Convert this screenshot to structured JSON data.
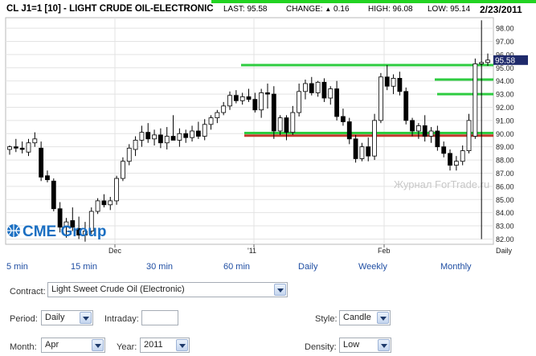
{
  "header": {
    "title": "CL J1=1 [10] - LIGHT CRUDE OIL-ELECTRONIC",
    "last": "LAST: 95.58",
    "change_label": "CHANGE:",
    "change_value": "0.16",
    "high": "HIGH: 96.08",
    "low": "LOW: 95.14",
    "date": "2/23/2011",
    "change_icon": "up-triangle-icon"
  },
  "logo": {
    "text": "CME Group"
  },
  "watermark": "Журнал ForTrade.ru",
  "colors": {
    "up_candle": "#ffffff",
    "down_candle": "#000000",
    "support_line_red": "#c0392b",
    "level_lines_green": "#2ecc40",
    "last_price_box": "#1f2a6b",
    "link_blue": "#1f4ea3",
    "logo_blue": "#1b6fc2"
  },
  "chart_data": {
    "type": "candlestick",
    "title": "CL J1=1 [10] - LIGHT CRUDE OIL-ELECTRONIC",
    "x_tick_labels": [
      "Dec",
      "'11",
      "Feb"
    ],
    "x_axis_label": "Daily",
    "y_ticks": [
      "82.00",
      "83.00",
      "84.00",
      "85.00",
      "86.00",
      "87.00",
      "88.00",
      "89.00",
      "90.00",
      "91.00",
      "92.00",
      "93.00",
      "94.00",
      "95.00",
      "96.00",
      "97.00",
      "98.00"
    ],
    "ylim": [
      81.6,
      98.8
    ],
    "last_price_label": "95.58",
    "horizontal_levels": [
      {
        "value": 95.2,
        "color": "green"
      },
      {
        "value": 94.1,
        "color": "green"
      },
      {
        "value": 93.0,
        "color": "green"
      },
      {
        "value": 90.05,
        "color": "green"
      },
      {
        "value": 89.85,
        "color": "red"
      }
    ],
    "candles": [
      {
        "o": 88.8,
        "h": 89.1,
        "l": 88.4,
        "c": 89.0
      },
      {
        "o": 89.0,
        "h": 89.6,
        "l": 88.6,
        "c": 88.9
      },
      {
        "o": 88.9,
        "h": 89.4,
        "l": 88.5,
        "c": 88.8
      },
      {
        "o": 88.6,
        "h": 89.6,
        "l": 88.3,
        "c": 89.3
      },
      {
        "o": 89.3,
        "h": 90.1,
        "l": 89.0,
        "c": 89.6
      },
      {
        "o": 88.9,
        "h": 89.4,
        "l": 86.4,
        "c": 86.7
      },
      {
        "o": 86.8,
        "h": 87.2,
        "l": 86.3,
        "c": 86.5
      },
      {
        "o": 86.4,
        "h": 86.6,
        "l": 84.1,
        "c": 84.3
      },
      {
        "o": 84.3,
        "h": 84.8,
        "l": 82.5,
        "c": 82.9
      },
      {
        "o": 82.9,
        "h": 83.6,
        "l": 82.1,
        "c": 83.3
      },
      {
        "o": 83.4,
        "h": 84.4,
        "l": 82.6,
        "c": 82.9
      },
      {
        "o": 82.8,
        "h": 83.7,
        "l": 82.0,
        "c": 82.3
      },
      {
        "o": 82.3,
        "h": 83.3,
        "l": 81.8,
        "c": 82.6
      },
      {
        "o": 82.6,
        "h": 84.4,
        "l": 82.4,
        "c": 84.1
      },
      {
        "o": 84.1,
        "h": 85.1,
        "l": 83.9,
        "c": 84.9
      },
      {
        "o": 84.9,
        "h": 85.4,
        "l": 84.4,
        "c": 84.6
      },
      {
        "o": 84.6,
        "h": 85.2,
        "l": 84.2,
        "c": 84.9
      },
      {
        "o": 84.9,
        "h": 86.8,
        "l": 84.6,
        "c": 86.6
      },
      {
        "o": 86.6,
        "h": 88.2,
        "l": 86.4,
        "c": 87.9
      },
      {
        "o": 87.9,
        "h": 89.2,
        "l": 87.6,
        "c": 88.9
      },
      {
        "o": 88.8,
        "h": 89.8,
        "l": 88.3,
        "c": 89.5
      },
      {
        "o": 89.5,
        "h": 90.6,
        "l": 89.0,
        "c": 90.1
      },
      {
        "o": 90.1,
        "h": 90.8,
        "l": 89.3,
        "c": 89.6
      },
      {
        "o": 89.6,
        "h": 90.3,
        "l": 89.1,
        "c": 89.9
      },
      {
        "o": 89.9,
        "h": 90.4,
        "l": 88.9,
        "c": 89.3
      },
      {
        "o": 89.3,
        "h": 90.5,
        "l": 88.8,
        "c": 89.8
      },
      {
        "o": 89.8,
        "h": 91.4,
        "l": 89.6,
        "c": 89.5
      },
      {
        "o": 89.5,
        "h": 90.4,
        "l": 89.0,
        "c": 90.0
      },
      {
        "o": 90.0,
        "h": 90.3,
        "l": 89.3,
        "c": 89.7
      },
      {
        "o": 89.7,
        "h": 90.6,
        "l": 89.4,
        "c": 90.2
      },
      {
        "o": 90.2,
        "h": 90.9,
        "l": 89.6,
        "c": 89.8
      },
      {
        "o": 89.8,
        "h": 91.1,
        "l": 89.5,
        "c": 90.7
      },
      {
        "o": 90.7,
        "h": 91.4,
        "l": 90.3,
        "c": 91.2
      },
      {
        "o": 91.2,
        "h": 91.8,
        "l": 90.8,
        "c": 91.6
      },
      {
        "o": 91.6,
        "h": 92.4,
        "l": 91.4,
        "c": 92.1
      },
      {
        "o": 92.1,
        "h": 93.2,
        "l": 91.8,
        "c": 92.9
      },
      {
        "o": 92.9,
        "h": 93.3,
        "l": 92.3,
        "c": 92.5
      },
      {
        "o": 92.5,
        "h": 93.1,
        "l": 92.2,
        "c": 92.8
      },
      {
        "o": 92.8,
        "h": 93.4,
        "l": 92.4,
        "c": 92.6
      },
      {
        "o": 92.6,
        "h": 93.1,
        "l": 91.6,
        "c": 91.8
      },
      {
        "o": 91.8,
        "h": 93.4,
        "l": 91.2,
        "c": 93.1
      },
      {
        "o": 93.1,
        "h": 93.8,
        "l": 91.9,
        "c": 93.0
      },
      {
        "o": 93.0,
        "h": 93.6,
        "l": 89.6,
        "c": 90.2
      },
      {
        "o": 90.2,
        "h": 91.4,
        "l": 89.9,
        "c": 91.2
      },
      {
        "o": 91.2,
        "h": 91.4,
        "l": 89.5,
        "c": 90.1
      },
      {
        "o": 90.1,
        "h": 92.1,
        "l": 89.9,
        "c": 91.6
      },
      {
        "o": 91.6,
        "h": 93.8,
        "l": 91.3,
        "c": 93.2
      },
      {
        "o": 93.2,
        "h": 94.1,
        "l": 92.6,
        "c": 93.8
      },
      {
        "o": 93.8,
        "h": 94.3,
        "l": 92.9,
        "c": 93.1
      },
      {
        "o": 93.1,
        "h": 94.0,
        "l": 92.8,
        "c": 93.9
      },
      {
        "o": 93.9,
        "h": 94.2,
        "l": 92.4,
        "c": 92.7
      },
      {
        "o": 92.7,
        "h": 93.6,
        "l": 92.2,
        "c": 93.4
      },
      {
        "o": 93.4,
        "h": 94.0,
        "l": 91.0,
        "c": 91.3
      },
      {
        "o": 91.3,
        "h": 91.9,
        "l": 90.6,
        "c": 90.9
      },
      {
        "o": 90.9,
        "h": 91.2,
        "l": 89.2,
        "c": 89.6
      },
      {
        "o": 89.6,
        "h": 89.9,
        "l": 87.8,
        "c": 88.1
      },
      {
        "o": 88.1,
        "h": 89.3,
        "l": 87.9,
        "c": 89.0
      },
      {
        "o": 89.0,
        "h": 89.7,
        "l": 87.9,
        "c": 88.3
      },
      {
        "o": 88.3,
        "h": 91.5,
        "l": 88.0,
        "c": 91.0
      },
      {
        "o": 91.0,
        "h": 94.6,
        "l": 90.8,
        "c": 94.3
      },
      {
        "o": 94.3,
        "h": 95.2,
        "l": 93.3,
        "c": 93.6
      },
      {
        "o": 93.6,
        "h": 94.5,
        "l": 93.0,
        "c": 94.2
      },
      {
        "o": 94.2,
        "h": 94.7,
        "l": 92.9,
        "c": 93.2
      },
      {
        "o": 93.2,
        "h": 93.5,
        "l": 90.7,
        "c": 91.0
      },
      {
        "o": 91.0,
        "h": 91.2,
        "l": 89.8,
        "c": 90.2
      },
      {
        "o": 90.2,
        "h": 90.8,
        "l": 89.6,
        "c": 90.6
      },
      {
        "o": 90.6,
        "h": 91.4,
        "l": 89.4,
        "c": 89.8
      },
      {
        "o": 89.8,
        "h": 90.5,
        "l": 89.3,
        "c": 90.2
      },
      {
        "o": 90.2,
        "h": 90.6,
        "l": 88.7,
        "c": 89.0
      },
      {
        "o": 89.0,
        "h": 89.4,
        "l": 88.2,
        "c": 88.5
      },
      {
        "o": 88.5,
        "h": 88.8,
        "l": 87.2,
        "c": 87.6
      },
      {
        "o": 87.6,
        "h": 88.3,
        "l": 87.2,
        "c": 87.9
      },
      {
        "o": 87.9,
        "h": 89.1,
        "l": 87.6,
        "c": 88.7
      },
      {
        "o": 88.7,
        "h": 91.5,
        "l": 88.5,
        "c": 91.0
      },
      {
        "o": 89.8,
        "h": 95.7,
        "l": 89.6,
        "c": 95.3
      },
      {
        "o": 95.3,
        "h": 98.6,
        "l": 82.0,
        "c": 95.4
      },
      {
        "o": 95.4,
        "h": 96.08,
        "l": 95.14,
        "c": 95.58
      }
    ]
  },
  "intervals": [
    "5 min",
    "15 min",
    "30 min",
    "60 min",
    "Daily",
    "Weekly",
    "Monthly"
  ],
  "interval_current": "Daily",
  "form": {
    "contract_label": "Contract:",
    "contract_value": "Light Sweet Crude Oil (Electronic)",
    "period_label": "Period:",
    "period_value": "Daily",
    "intraday_label": "Intraday:",
    "intraday_value": "",
    "style_label": "Style:",
    "style_value": "Candle",
    "month_label": "Month:",
    "month_value": "Apr",
    "year_label": "Year:",
    "year_value": "2011",
    "density_label": "Density:",
    "density_value": "Low"
  }
}
